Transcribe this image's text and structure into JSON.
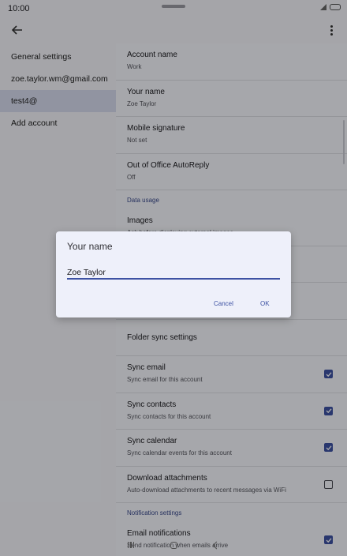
{
  "status": {
    "time": "10:00"
  },
  "sidebar": {
    "items": [
      {
        "label": "General settings"
      },
      {
        "label": "zoe.taylor.wm@gmail.com"
      },
      {
        "label": "test4@"
      },
      {
        "label": "Add account"
      }
    ]
  },
  "settings": {
    "account_name": {
      "title": "Account name",
      "value": "Work"
    },
    "your_name": {
      "title": "Your name",
      "value": "Zoe Taylor"
    },
    "signature": {
      "title": "Mobile signature",
      "value": "Not set"
    },
    "ooo": {
      "title": "Out of Office AutoReply",
      "value": "Off"
    },
    "data_usage_header": "Data usage",
    "images": {
      "title": "Images",
      "value": "Ask before displaying external images"
    },
    "folder_sync": {
      "title": "Folder sync settings"
    },
    "sync_email": {
      "title": "Sync email",
      "value": "Sync email for this account",
      "checked": true
    },
    "sync_contacts": {
      "title": "Sync contacts",
      "value": "Sync contacts for this account",
      "checked": true
    },
    "sync_calendar": {
      "title": "Sync calendar",
      "value": "Sync calendar events for this account",
      "checked": true
    },
    "download_attachments": {
      "title": "Download attachments",
      "value": "Auto-download attachments to recent messages via WiFi",
      "checked": false
    },
    "notification_header": "Notification settings",
    "email_notifications": {
      "title": "Email notifications",
      "value": "Send notification when emails arrive",
      "checked": true
    }
  },
  "dialog": {
    "title": "Your name",
    "input_value": "Zoe Taylor",
    "cancel_label": "Cancel",
    "ok_label": "OK"
  },
  "colors": {
    "accent": "#3d52a3",
    "selected": "#d6dbee"
  }
}
